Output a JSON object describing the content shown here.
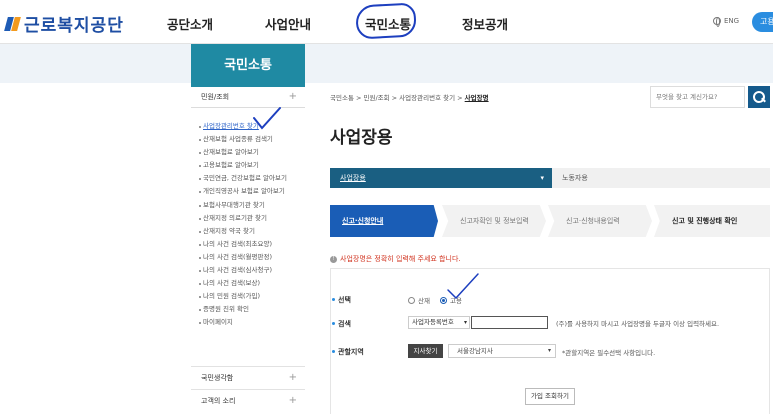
{
  "header": {
    "logo_text": "근로복지공단",
    "nav": [
      "공단소개",
      "사업안내",
      "국민소통",
      "정보공개"
    ],
    "lang": "ENG",
    "pill": "고용"
  },
  "banner_title": "국민소통",
  "left_nav": {
    "head": "민원/조회",
    "items": [
      "사업장관리번호 찾기",
      "산재보험 사업종류 검색기",
      "산재보험료 알아보기",
      "고용보험료 알아보기",
      "국민연금, 건강보험료 알아보기",
      "개인직영공사 보험료 알아보기",
      "보험사무대행기관 찾기",
      "산재지정 의료기관 찾기",
      "산재지정 약국 찾기",
      "나의 사건 검색(최초요양)",
      "나의 사건 검색(월평판정)",
      "나의 사건 검색(심사청구)",
      "나의 사건 검색(보상)",
      "나의 민원 검색(가입)",
      "증명원 진위 확인",
      "마이페이지"
    ],
    "footer": [
      "국민생각함",
      "고객의 소리"
    ]
  },
  "breadcrumb": {
    "path": "국민소통 > 민원/조회 > 사업장관리번호 찾기 > ",
    "current": "사업장명"
  },
  "search": {
    "placeholder": "무엇을 찾고 계신가요?"
  },
  "page_title": "사업장용",
  "selector": {
    "active": "사업장용",
    "other": "노동자용"
  },
  "steps": [
    "신고·신청안내",
    "신고자확인 및 정보입력",
    "신고·신청내용입력",
    "신고 및 진행상태 확인"
  ],
  "warning": "사업장명은 정확히 입력해 주세요 합니다.",
  "form": {
    "select_label": "선택",
    "radio_1": "산재",
    "radio_2": "고용",
    "search_label": "검색",
    "search_select": "사업자등록번호",
    "search_note": "(주)를 사용하지 마시고 사업장명을 두글자 이상 입력하세요.",
    "region_label": "관할지역",
    "branch_button": "지사찾기",
    "branch_select": "서울강남지사",
    "region_note": "*관할지역은 필수선택 사항입니다.",
    "submit": "가입 조회하기"
  },
  "colors": {
    "brand_blue": "#1e4ea3",
    "teal": "#1f8aa3",
    "step_active": "#1a5db6",
    "warning": "#d1331f"
  }
}
